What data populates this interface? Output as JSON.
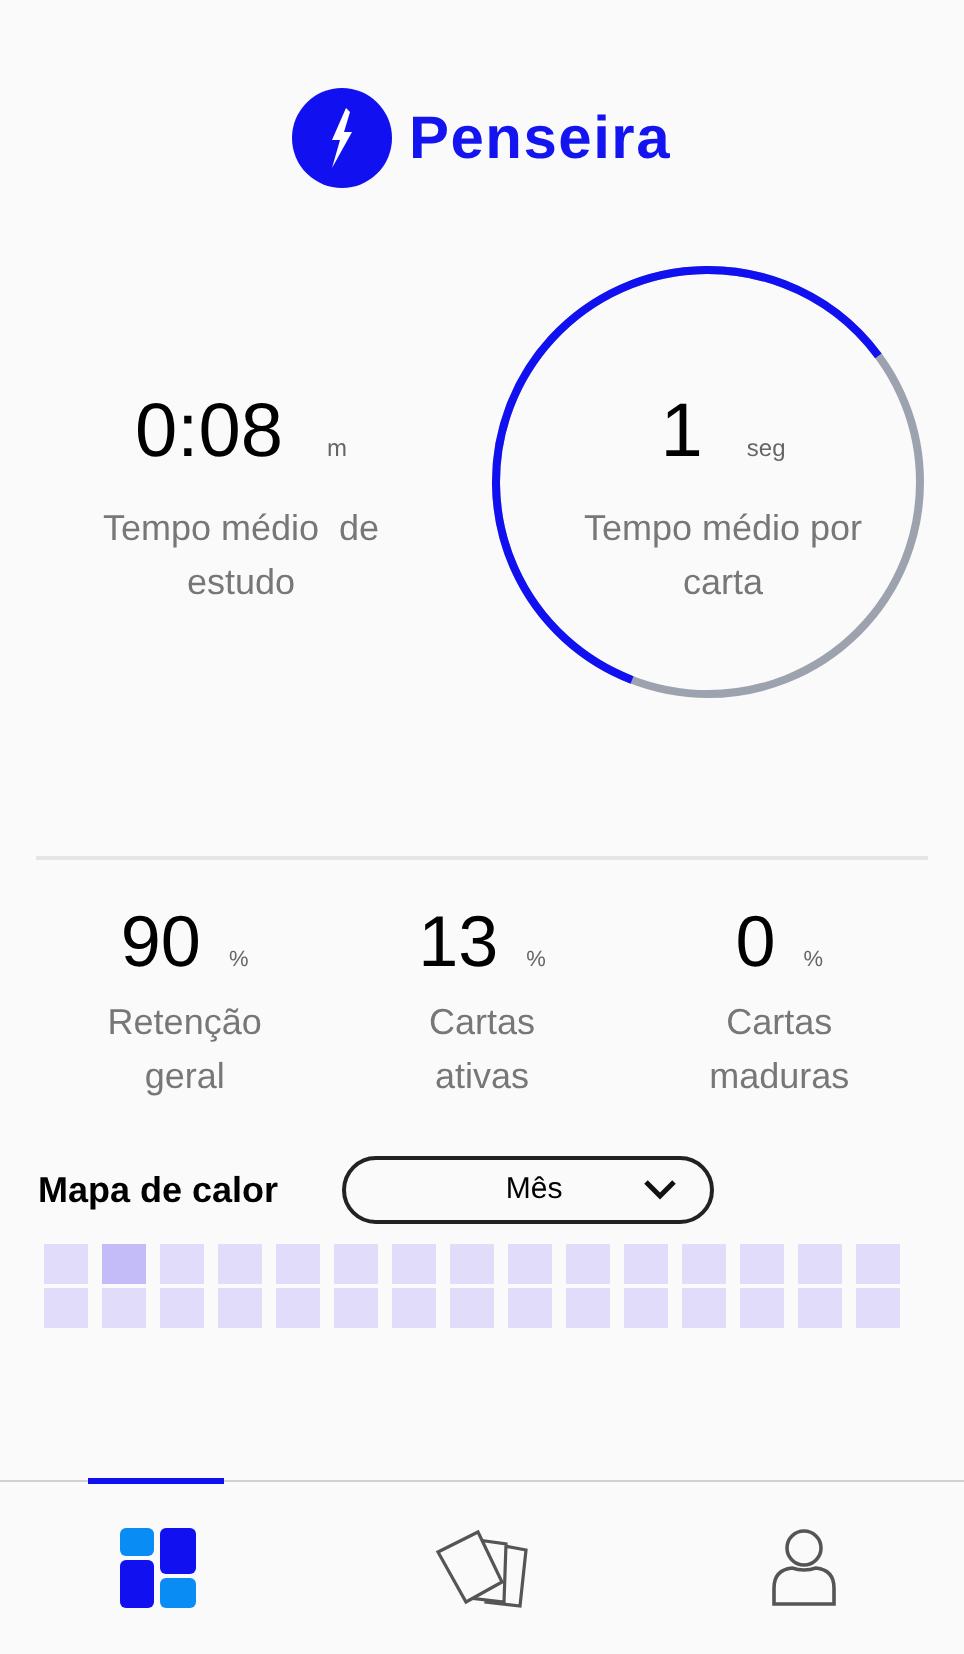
{
  "logo": {
    "name": "Penseira"
  },
  "main_stats": [
    {
      "kind": "plain",
      "value": "0:08",
      "unit": "m",
      "label": "Tempo médio  de estudo"
    },
    {
      "kind": "ring",
      "value": "1",
      "unit": "seg",
      "label": "Tempo médio por carta"
    }
  ],
  "stats": [
    {
      "value": "90",
      "unit": "%",
      "label": "Retenção geral"
    },
    {
      "value": "13",
      "unit": "%",
      "label": "Cartas ativas"
    },
    {
      "value": "0",
      "unit": "%",
      "label": "Cartas maduras"
    }
  ],
  "heatmap": {
    "title": "Mapa de calor",
    "period": "Mês",
    "rows": [
      {
        "cells": [
          {
            "color": "#e0dcfa"
          },
          {
            "color": "#c4bcf8"
          },
          {
            "color": "#e0dcfa"
          },
          {
            "color": "#e0dcfa"
          },
          {
            "color": "#e0dcfa"
          },
          {
            "color": "#e0dcfa"
          },
          {
            "color": "#e0dcfa"
          },
          {
            "color": "#e0dcfa"
          },
          {
            "color": "#e0dcfa"
          },
          {
            "color": "#e0dcfa"
          },
          {
            "color": "#e0dcfa"
          },
          {
            "color": "#e0dcfa"
          },
          {
            "color": "#e0dcfa"
          },
          {
            "color": "#e0dcfa"
          },
          {
            "color": "#e0dcfa"
          }
        ]
      },
      {
        "cells": [
          {
            "color": "#e0dcfa"
          },
          {
            "color": "#e0dcfa"
          },
          {
            "color": "#e0dcfa"
          },
          {
            "color": "#e0dcfa"
          },
          {
            "color": "#e0dcfa"
          },
          {
            "color": "#e0dcfa"
          },
          {
            "color": "#e0dcfa"
          },
          {
            "color": "#e0dcfa"
          },
          {
            "color": "#e0dcfa"
          },
          {
            "color": "#e0dcfa"
          },
          {
            "color": "#e0dcfa"
          },
          {
            "color": "#e0dcfa"
          },
          {
            "color": "#e0dcfa"
          },
          {
            "color": "#e0dcfa"
          },
          {
            "color": "#e0dcfa"
          }
        ]
      }
    ]
  },
  "nav": [
    {
      "kind": "dashboard",
      "selected": true
    },
    {
      "kind": "cards",
      "selected": false
    },
    {
      "kind": "profile",
      "selected": false
    }
  ]
}
